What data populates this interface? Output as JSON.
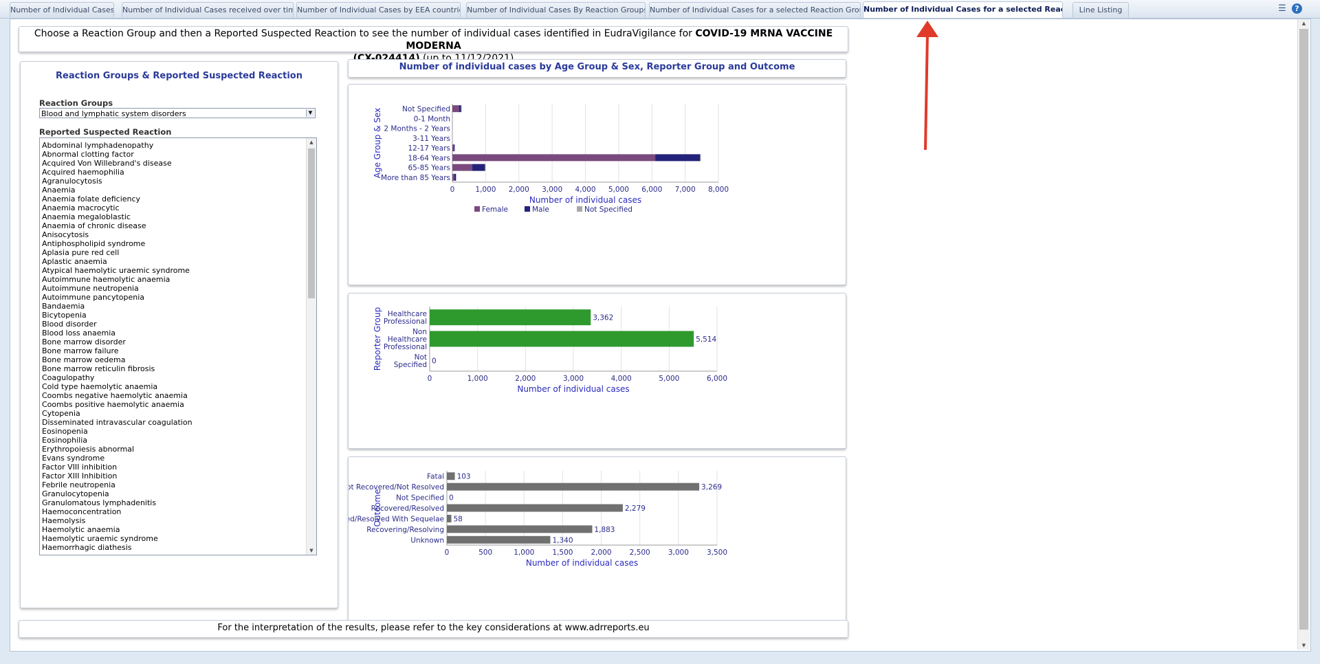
{
  "tabs": [
    {
      "label": "Number of Individual Cases",
      "active": false
    },
    {
      "label": "Number of Individual Cases received over time",
      "active": false
    },
    {
      "label": "Number of Individual Cases by EEA countries",
      "active": false
    },
    {
      "label": "Number of Individual Cases By Reaction Groups",
      "active": false
    },
    {
      "label": "Number of Individual Cases for a selected Reaction Group",
      "active": false
    },
    {
      "label": "Number of Individual Cases for a selected Reaction",
      "active": true
    },
    {
      "label": "Line Listing",
      "active": false
    }
  ],
  "toolbar": {
    "page_options_icon": "list-options-icon",
    "help_icon": "help-icon",
    "help_glyph": "?"
  },
  "header": {
    "line1_prefix": "Choose a Reaction Group and then a Reported Suspected Reaction to see the number of individual cases identified in EudraVigilance for ",
    "product": "COVID-19 MRNA VACCINE MODERNA",
    "code": "(CX-024414)",
    "date_suffix": " (up to 11/12/2021)"
  },
  "left_panel": {
    "title": "Reaction Groups & Reported Suspected Reaction",
    "reaction_groups_label": "Reaction Groups",
    "reaction_groups_value": "Blood and lymphatic system disorders",
    "reactions_label": "Reported Suspected Reaction",
    "reactions": [
      "Abdominal lymphadenopathy",
      "Abnormal clotting factor",
      "Acquired Von Willebrand's disease",
      "Acquired haemophilia",
      "Agranulocytosis",
      "Anaemia",
      "Anaemia folate deficiency",
      "Anaemia macrocytic",
      "Anaemia megaloblastic",
      "Anaemia of chronic disease",
      "Anisocytosis",
      "Antiphospholipid syndrome",
      "Aplasia pure red cell",
      "Aplastic anaemia",
      "Atypical haemolytic uraemic syndrome",
      "Autoimmune haemolytic anaemia",
      "Autoimmune neutropenia",
      "Autoimmune pancytopenia",
      "Bandaemia",
      "Bicytopenia",
      "Blood disorder",
      "Blood loss anaemia",
      "Bone marrow disorder",
      "Bone marrow failure",
      "Bone marrow oedema",
      "Bone marrow reticulin fibrosis",
      "Coagulopathy",
      "Cold type haemolytic anaemia",
      "Coombs negative haemolytic anaemia",
      "Coombs positive haemolytic anaemia",
      "Cytopenia",
      "Disseminated intravascular coagulation",
      "Eosinopenia",
      "Eosinophilia",
      "Erythropoiesis abnormal",
      "Evans syndrome",
      "Factor VIII inhibition",
      "Factor XIII Inhibition",
      "Febrile neutropenia",
      "Granulocytopenia",
      "Granulomatous lymphadenitis",
      "Haemoconcentration",
      "Haemolysis",
      "Haemolytic anaemia",
      "Haemolytic uraemic syndrome",
      "Haemorrhagic diathesis"
    ]
  },
  "charts_header": "Number of individual cases by Age Group & Sex, Reporter Group and Outcome",
  "chart_data": [
    {
      "type": "bar",
      "orientation": "horizontal",
      "stacked": true,
      "categories": [
        "Not Specified",
        "0-1 Month",
        "2 Months - 2 Years",
        "3-11 Years",
        "12-17 Years",
        "18-64 Years",
        "65-85 Years",
        "More than 85 Years"
      ],
      "series": [
        {
          "name": "Female",
          "color": "#7a4a7e",
          "values": [
            200,
            0,
            0,
            0,
            45,
            6100,
            600,
            60
          ]
        },
        {
          "name": "Male",
          "color": "#23237a",
          "values": [
            60,
            0,
            0,
            0,
            25,
            1350,
            380,
            50
          ]
        },
        {
          "name": "Not Specified",
          "color": "#a9a9a9",
          "values": [
            5,
            0,
            0,
            0,
            0,
            20,
            5,
            0
          ]
        }
      ],
      "xlabel": "Number of individual cases",
      "ylabel": "Age Group & Sex",
      "xticks": [
        "0",
        "1,000",
        "2,000",
        "3,000",
        "4,000",
        "5,000",
        "6,000",
        "7,000",
        "8,000"
      ],
      "xlim": [
        0,
        8000
      ],
      "legend_position": "bottom",
      "grid": true
    },
    {
      "type": "bar",
      "orientation": "horizontal",
      "categories": [
        "Healthcare Professional",
        "Non Healthcare Professional",
        "Not Specified"
      ],
      "category_lines": [
        [
          "Healthcare",
          "Professional"
        ],
        [
          "Non",
          "Healthcare",
          "Professional"
        ],
        [
          "Not",
          "Specified"
        ]
      ],
      "values": [
        3362,
        5514,
        0
      ],
      "value_labels": [
        "3,362",
        "5,514",
        "0"
      ],
      "color": "#2e9a2e",
      "xlabel": "Number of individual cases",
      "ylabel": "Reporter Group",
      "xticks": [
        "0",
        "1,000",
        "2,000",
        "3,000",
        "4,000",
        "5,000",
        "6,000"
      ],
      "xlim": [
        0,
        6000
      ],
      "grid": true
    },
    {
      "type": "bar",
      "orientation": "horizontal",
      "categories": [
        "Fatal",
        "Not Recovered/Not Resolved",
        "Not Specified",
        "Recovered/Resolved",
        "Recovered/Resolved With Sequelae",
        "Recovering/Resolving",
        "Unknown"
      ],
      "values": [
        103,
        3269,
        0,
        2279,
        58,
        1883,
        1340
      ],
      "value_labels": [
        "103",
        "3,269",
        "0",
        "2,279",
        "58",
        "1,883",
        "1,340"
      ],
      "color": "#707070",
      "xlabel": "Number of individual cases",
      "ylabel": "Outcome",
      "xticks": [
        "0",
        "500",
        "1,000",
        "1,500",
        "2,000",
        "2,500",
        "3,000",
        "3,500"
      ],
      "xlim": [
        0,
        3500
      ],
      "grid": true
    }
  ],
  "footer": "For the interpretation of the results, please refer to the key considerations at www.adrreports.eu"
}
